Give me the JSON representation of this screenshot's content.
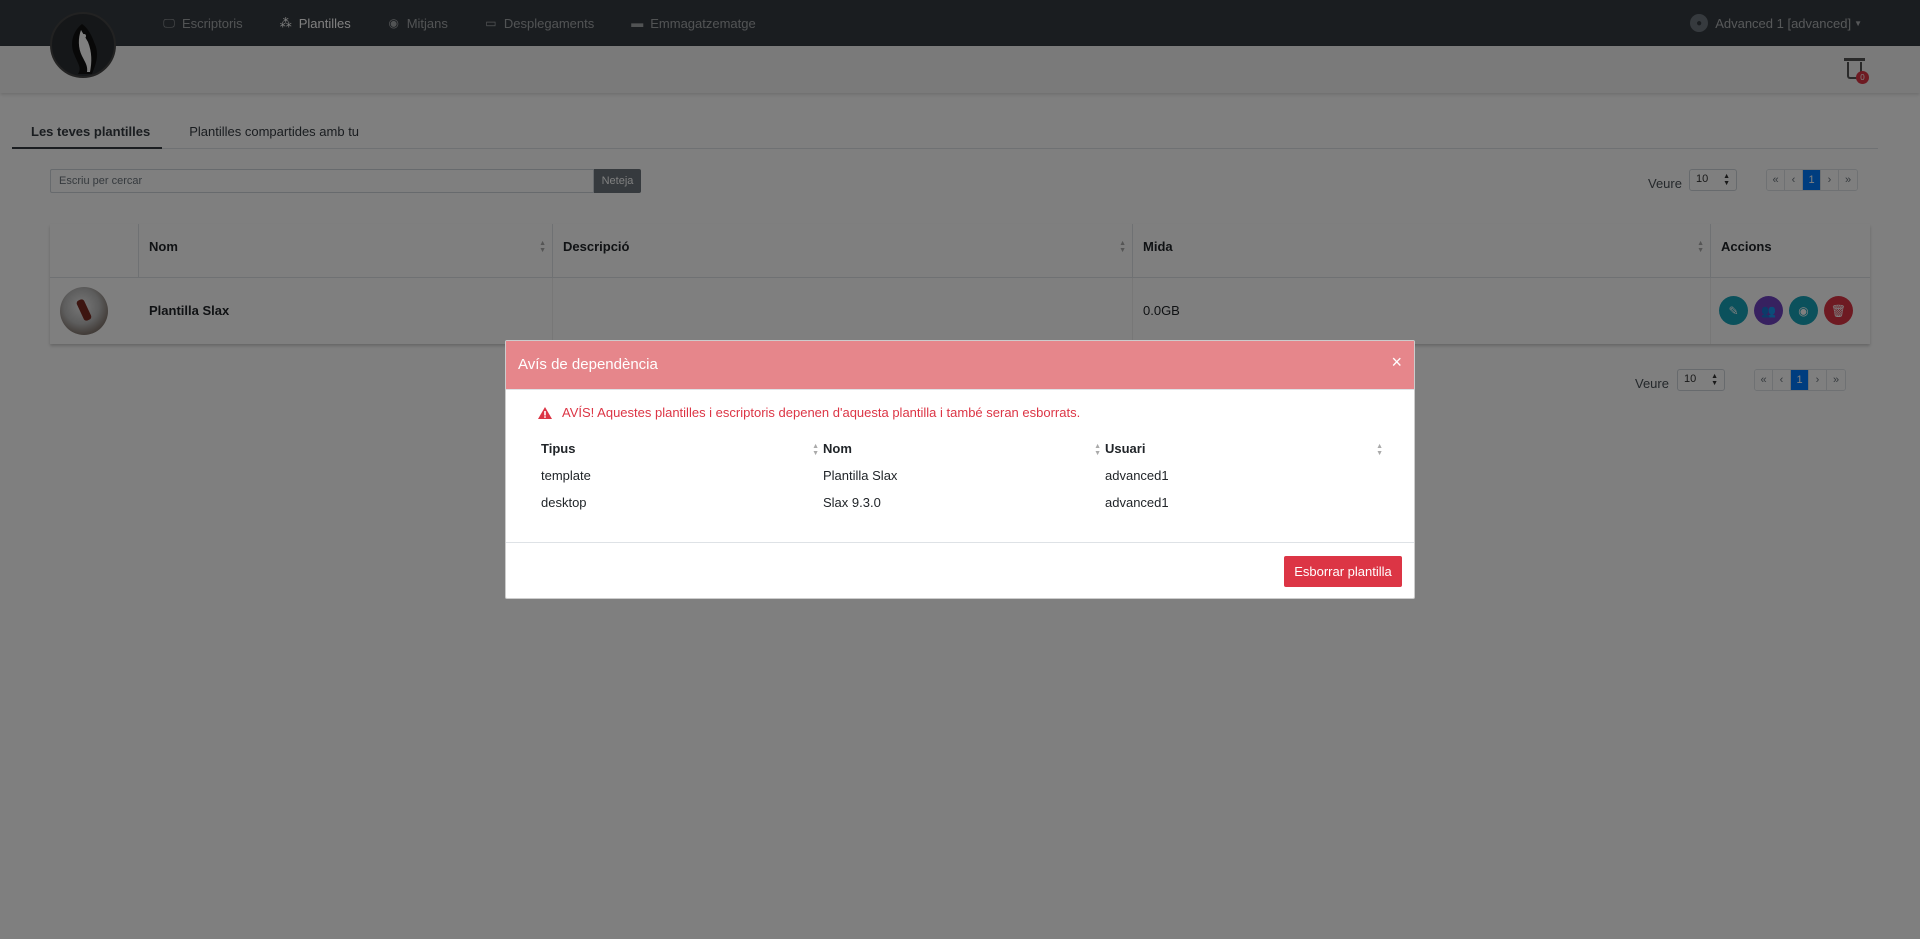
{
  "navbar": {
    "items": [
      {
        "label": "Escriptoris",
        "icon": "desktop-icon",
        "active": false
      },
      {
        "label": "Plantilles",
        "icon": "cubes-icon",
        "active": true
      },
      {
        "label": "Mitjans",
        "icon": "disc-icon",
        "active": false
      },
      {
        "label": "Desplegaments",
        "icon": "tv-icon",
        "active": false
      },
      {
        "label": "Emmagatzematge",
        "icon": "folder-icon",
        "active": false
      }
    ],
    "user": "Advanced 1 [advanced]"
  },
  "trash": {
    "count": "0"
  },
  "tabs": [
    {
      "label": "Les teves plantilles",
      "active": true
    },
    {
      "label": "Plantilles compartides amb tu",
      "active": false
    }
  ],
  "search": {
    "placeholder": "Escriu per cercar",
    "clear_label": "Neteja"
  },
  "pager": {
    "label": "Veure",
    "per_page": "10",
    "first": "«",
    "prev": "‹",
    "current": "1",
    "next": "›",
    "last": "»"
  },
  "table": {
    "columns": [
      "Nom",
      "Descripció",
      "Mida",
      "Accions"
    ],
    "rows": [
      {
        "name": "Plantilla Slax",
        "description": "",
        "size": "0.0GB"
      }
    ]
  },
  "modal": {
    "title": "Avís de dependència",
    "close": "×",
    "warning": "AVÍS! Aquestes plantilles i escriptoris depenen d'aquesta plantilla i també seran esborrats.",
    "columns": [
      "Tipus",
      "Nom",
      "Usuari"
    ],
    "rows": [
      {
        "type": "template",
        "name": "Plantilla Slax",
        "user": "advanced1"
      },
      {
        "type": "desktop",
        "name": "Slax 9.3.0",
        "user": "advanced1"
      }
    ],
    "delete_label": "Esborrar plantilla"
  },
  "colors": {
    "navbar": "#343a40",
    "modal_header": "#e6868b",
    "danger": "#dc3545",
    "primary": "#007bff",
    "edit_button": "#17a2b8",
    "share_button": "#6f42c1",
    "view_button": "#17a2b8",
    "delete_button": "#dc3545"
  }
}
